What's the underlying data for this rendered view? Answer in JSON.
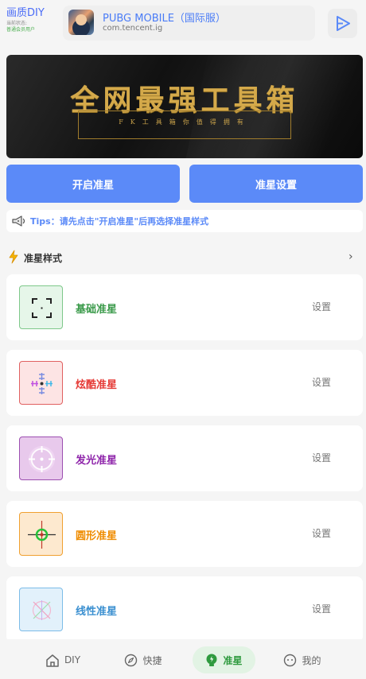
{
  "header": {
    "brand_title": "画质DIY",
    "status_label": "当前状态:",
    "status_value": "普通会员用户",
    "game_name": "PUBG MOBILE（国际服）",
    "game_package": "com.tencent.ig"
  },
  "banner": {
    "title": "全网最强工具箱",
    "subtitle": "FK工具箱你值得拥有"
  },
  "actions": {
    "enable_label": "开启准星",
    "settings_label": "准星设置"
  },
  "tips": {
    "text": "Tips：请先点击\"开启准星\"后再选择准星样式"
  },
  "section": {
    "title": "准星样式",
    "arrow": "›"
  },
  "crosshairs": [
    {
      "label": "基础准星",
      "setting": "设置",
      "color": "#3a9a4a",
      "icon_bg": "#e6f6e9",
      "icon_border": "#7ec88a",
      "icon": "basic-crosshair-icon"
    },
    {
      "label": "炫酷准星",
      "setting": "设置",
      "color": "#e53935",
      "icon_bg": "#fde4e4",
      "icon_border": "#e06060",
      "icon": "cool-crosshair-icon"
    },
    {
      "label": "发光准星",
      "setting": "设置",
      "color": "#8e24aa",
      "icon_bg": "#e8c9ec",
      "icon_border": "#9c4fb0",
      "icon": "glow-crosshair-icon"
    },
    {
      "label": "圆形准星",
      "setting": "设置",
      "color": "#ef8c00",
      "icon_bg": "#fde9cf",
      "icon_border": "#f0a030",
      "icon": "circle-crosshair-icon"
    },
    {
      "label": "线性准星",
      "setting": "设置",
      "color": "#3a8fd0",
      "icon_bg": "#e2f1fb",
      "icon_border": "#7cbce8",
      "icon": "linear-crosshair-icon"
    }
  ],
  "tabs": [
    {
      "label": "DIY",
      "icon": "home-icon"
    },
    {
      "label": "快捷",
      "icon": "compass-icon"
    },
    {
      "label": "准星",
      "icon": "lightbulb-icon",
      "active": true
    },
    {
      "label": "我的",
      "icon": "face-icon"
    }
  ],
  "colors": {
    "accent": "#5b8af8",
    "active_tab": "#2e9a3e"
  }
}
